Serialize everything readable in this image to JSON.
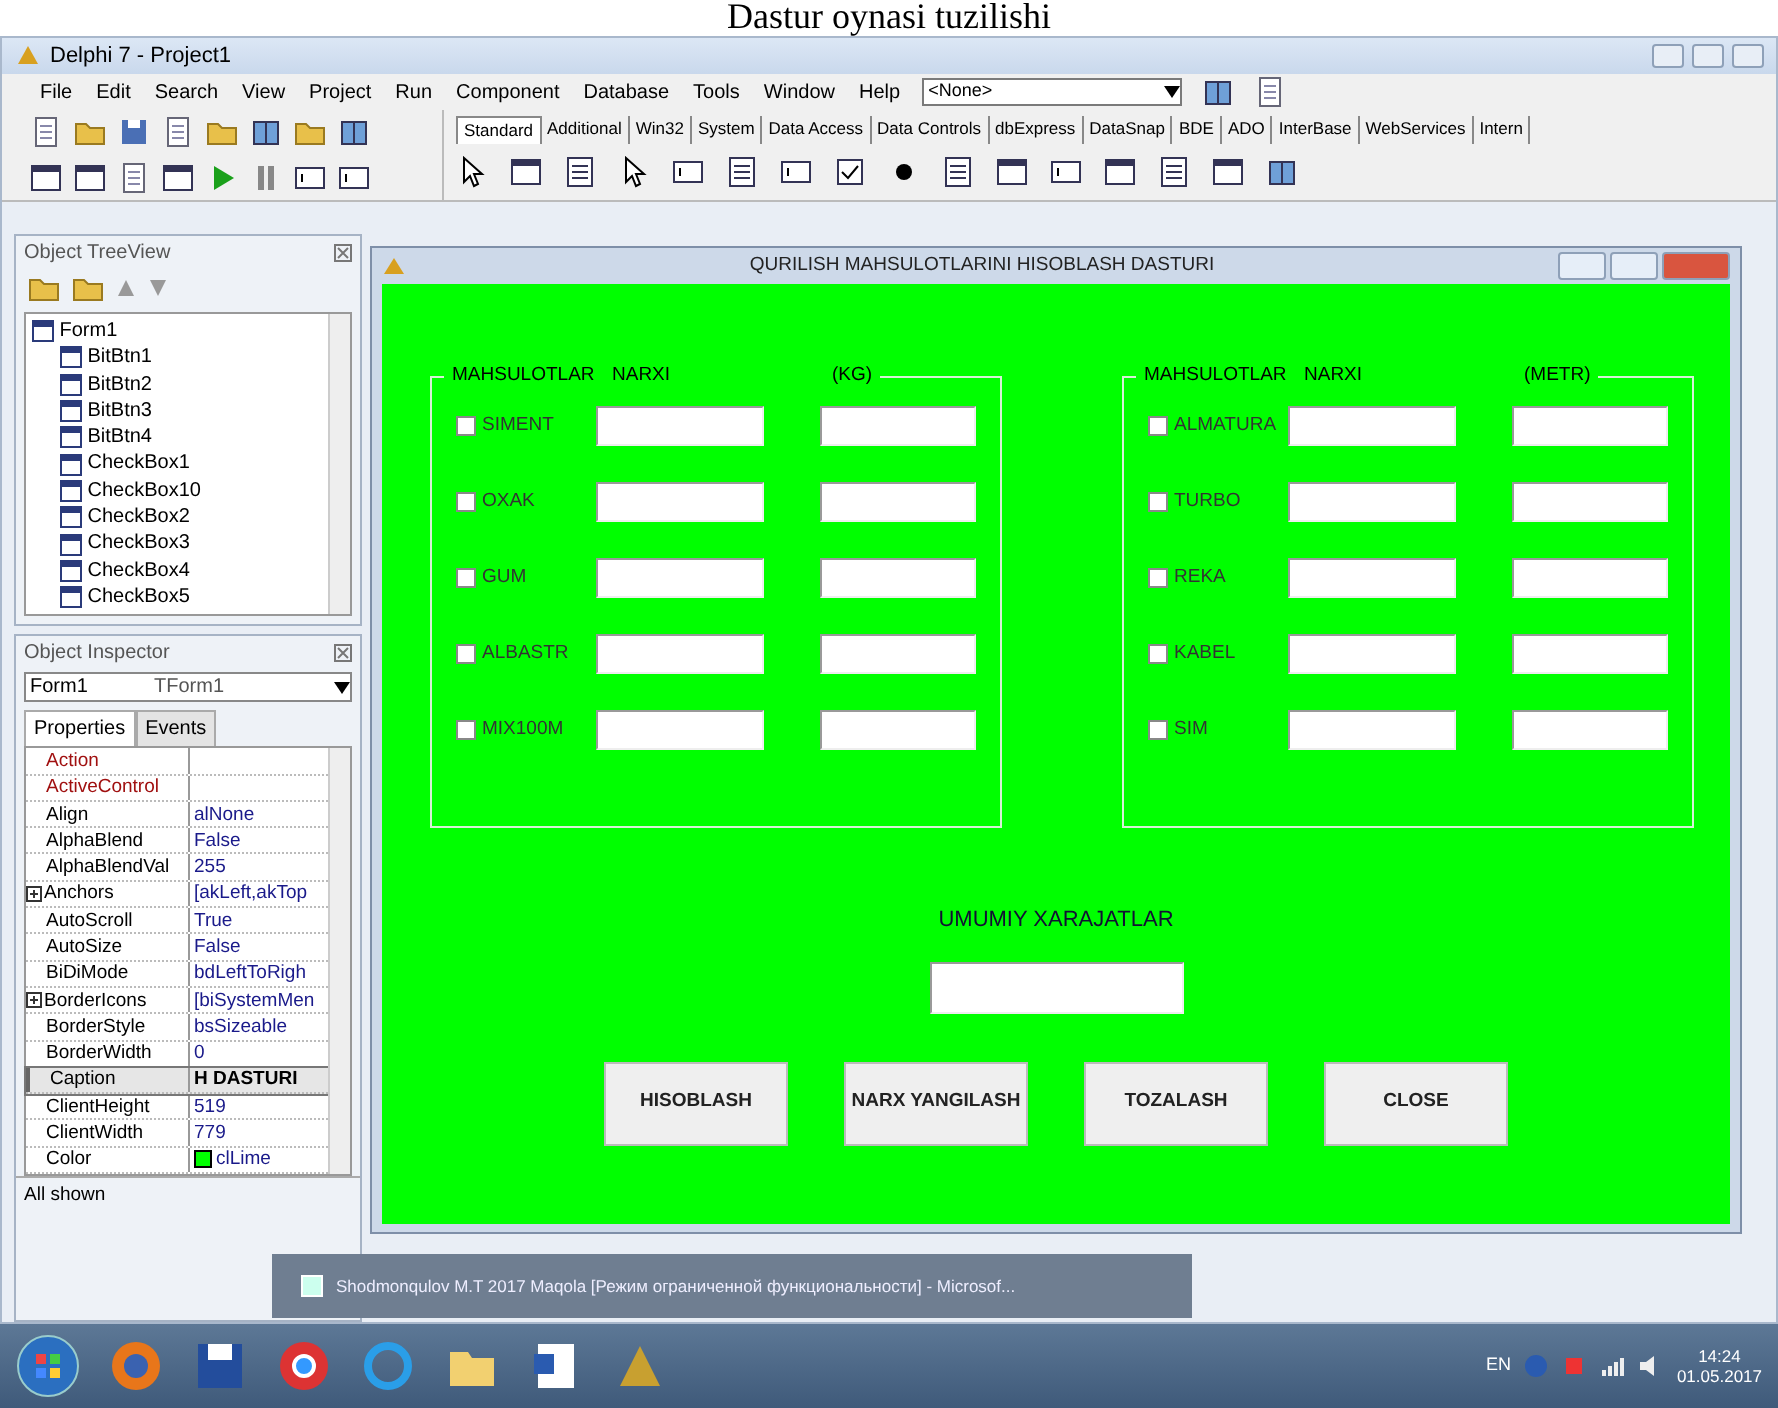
{
  "caption": "Dastur oynasi tuzilishi",
  "ide": {
    "title": "Delphi 7 - Project1",
    "menu": [
      "File",
      "Edit",
      "Search",
      "View",
      "Project",
      "Run",
      "Component",
      "Database",
      "Tools",
      "Window",
      "Help"
    ],
    "combo": {
      "value": "<None>"
    },
    "palette_tabs": [
      {
        "label": "Standard",
        "selected": true
      },
      {
        "label": "Additional",
        "selected": false
      },
      {
        "label": "Win32",
        "selected": false
      },
      {
        "label": "System",
        "selected": false
      },
      {
        "label": "Data Access",
        "selected": false
      },
      {
        "label": "Data Controls",
        "selected": false
      },
      {
        "label": "dbExpress",
        "selected": false
      },
      {
        "label": "DataSnap",
        "selected": false
      },
      {
        "label": "BDE",
        "selected": false
      },
      {
        "label": "ADO",
        "selected": false
      },
      {
        "label": "InterBase",
        "selected": false
      },
      {
        "label": "WebServices",
        "selected": false
      },
      {
        "label": "Intern",
        "selected": false
      }
    ]
  },
  "tree_view": {
    "title": "Object TreeView",
    "root": {
      "label": "Form1",
      "children": [
        {
          "label": "BitBtn1"
        },
        {
          "label": "BitBtn2"
        },
        {
          "label": "BitBtn3"
        },
        {
          "label": "BitBtn4"
        },
        {
          "label": "CheckBox1"
        },
        {
          "label": "CheckBox10"
        },
        {
          "label": "CheckBox2"
        },
        {
          "label": "CheckBox3"
        },
        {
          "label": "CheckBox4"
        },
        {
          "label": "CheckBox5"
        }
      ]
    }
  },
  "inspector": {
    "title": "Object Inspector",
    "object": "Form1",
    "type": "TForm1",
    "tabs": [
      {
        "label": "Properties",
        "selected": true
      },
      {
        "label": "Events",
        "selected": false
      }
    ],
    "properties": [
      {
        "kind": "reference",
        "name": "Action",
        "selected": false
      },
      {
        "kind": "reference",
        "name": "ActiveControl",
        "selected": false
      },
      {
        "kind": "plain",
        "name": "Align",
        "value": "alNone",
        "selected": false
      },
      {
        "kind": "plain",
        "name": "AlphaBlend",
        "value": "False",
        "selected": false
      },
      {
        "kind": "plain",
        "name": "AlphaBlendVal",
        "value": "255",
        "selected": false
      },
      {
        "kind": "expandable",
        "name": "Anchors",
        "value": "[akLeft,akTop",
        "selected": false
      },
      {
        "kind": "plain",
        "name": "AutoScroll",
        "value": "True",
        "selected": false
      },
      {
        "kind": "plain",
        "name": "AutoSize",
        "value": "False",
        "selected": false
      },
      {
        "kind": "plain",
        "name": "BiDiMode",
        "value": "bdLeftToRigh",
        "selected": false
      },
      {
        "kind": "expandable",
        "name": "BorderIcons",
        "value": "[biSystemMen",
        "selected": false
      },
      {
        "kind": "plain",
        "name": "BorderStyle",
        "value": "bsSizeable",
        "selected": false
      },
      {
        "kind": "plain",
        "name": "BorderWidth",
        "value": "0",
        "selected": false
      },
      {
        "kind": "plain",
        "name": "Caption",
        "value": "H DASTURI",
        "selected": true
      },
      {
        "kind": "plain",
        "name": "ClientHeight",
        "value": "519",
        "selected": false
      },
      {
        "kind": "plain",
        "name": "ClientWidth",
        "value": "779",
        "selected": false
      },
      {
        "kind": "color",
        "name": "Color",
        "value": "clLime",
        "color": "#00ff00",
        "selected": false
      }
    ],
    "status": "All shown"
  },
  "form": {
    "title": "QURILISH MAHSULOTLARINI HISOBLASH DASTURI",
    "groups": [
      {
        "headers": [
          "MAHSULOTLAR",
          "NARXI",
          "(KG)"
        ],
        "items": [
          {
            "label": "SIMENT",
            "checked": false
          },
          {
            "label": "OXAK",
            "checked": false
          },
          {
            "label": "GUM",
            "checked": false
          },
          {
            "label": "ALBASTR",
            "checked": false
          },
          {
            "label": "MIX100M",
            "checked": false
          }
        ]
      },
      {
        "headers": [
          "MAHSULOTLAR",
          "NARXI",
          "(METR)"
        ],
        "items": [
          {
            "label": "ALMATURA",
            "checked": false
          },
          {
            "label": "TURBO",
            "checked": false
          },
          {
            "label": "REKA",
            "checked": false
          },
          {
            "label": "KABEL",
            "checked": false
          },
          {
            "label": "SIM",
            "checked": false
          }
        ]
      }
    ],
    "total_label": "UMUMIY XARAJATLAR",
    "buttons": [
      "HISOBLASH",
      "NARX YANGILASH",
      "TOZALASH",
      "CLOSE"
    ]
  },
  "taskbar_popup": "Shodmonqulov M.T 2017 Maqola [Режим ограниченной функциональности] - Microsof...",
  "tray": {
    "language": "EN",
    "time": "14:24",
    "date": "01.05.2017"
  }
}
